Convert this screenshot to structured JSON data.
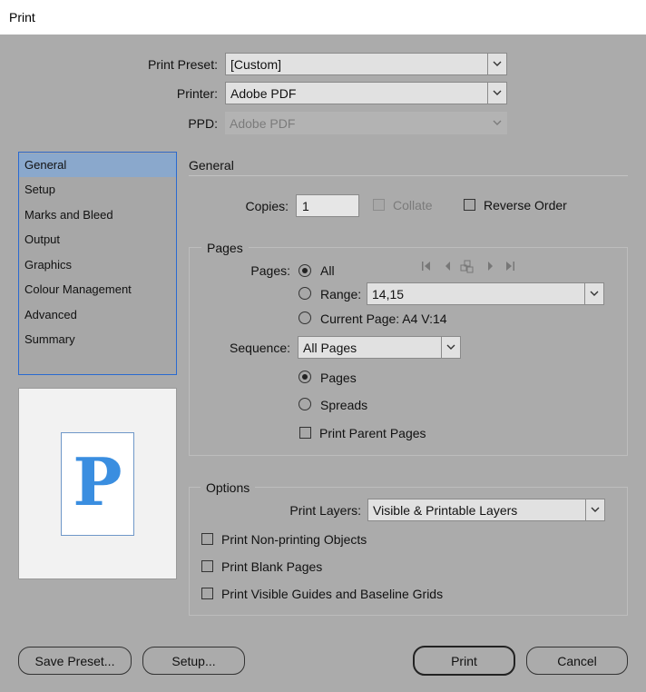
{
  "window": {
    "title": "Print"
  },
  "top": {
    "print_preset_label": "Print Preset:",
    "print_preset_value": "[Custom]",
    "printer_label": "Printer:",
    "printer_value": "Adobe PDF",
    "ppd_label": "PPD:",
    "ppd_value": "Adobe PDF"
  },
  "sidebar": {
    "items": [
      {
        "label": "General",
        "selected": true
      },
      {
        "label": "Setup"
      },
      {
        "label": "Marks and Bleed"
      },
      {
        "label": "Output"
      },
      {
        "label": "Graphics"
      },
      {
        "label": "Colour Management"
      },
      {
        "label": "Advanced"
      },
      {
        "label": "Summary"
      }
    ]
  },
  "preview": {
    "letter": "P",
    "letter_color": "#3a8ee0"
  },
  "general": {
    "heading": "General",
    "copies_label": "Copies:",
    "copies_value": "1",
    "collate_label": "Collate",
    "reverse_order_label": "Reverse Order"
  },
  "pages": {
    "heading": "Pages",
    "pages_label": "Pages:",
    "all_label": "All",
    "range_label": "Range:",
    "range_value": "14,15",
    "current_page_label": "Current Page: A4 V:14",
    "sequence_label": "Sequence:",
    "sequence_value": "All Pages",
    "pages_option_label": "Pages",
    "spreads_option_label": "Spreads",
    "print_parent_pages_label": "Print Parent Pages"
  },
  "options": {
    "heading": "Options",
    "print_layers_label": "Print Layers:",
    "print_layers_value": "Visible & Printable Layers",
    "non_printing_label": "Print Non-printing Objects",
    "blank_pages_label": "Print Blank Pages",
    "guides_label": "Print Visible Guides and Baseline Grids"
  },
  "buttons": {
    "save_preset": "Save Preset...",
    "setup": "Setup...",
    "print": "Print",
    "cancel": "Cancel"
  }
}
